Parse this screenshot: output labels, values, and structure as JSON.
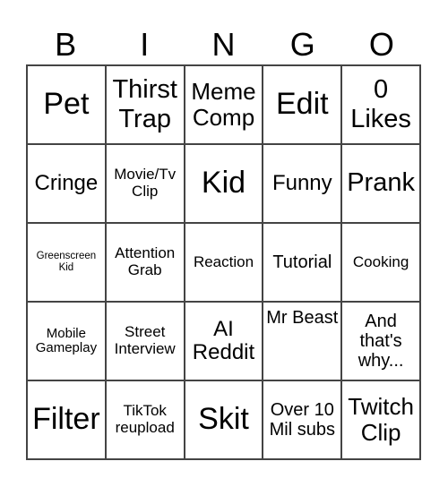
{
  "card": {
    "header": [
      "B",
      "I",
      "N",
      "G",
      "O"
    ],
    "rows": [
      [
        "Pet",
        "Thirst Trap",
        "Meme Comp",
        "Edit",
        "0 Likes"
      ],
      [
        "Cringe",
        "Movie/Tv Clip",
        "Kid",
        "Funny",
        "Prank"
      ],
      [
        "Greenscreen Kid",
        "Attention Grab",
        "Reaction",
        "Tutorial",
        "Cooking"
      ],
      [
        "Mobile Gameplay",
        "Street Interview",
        "AI Reddit",
        "Mr Beast",
        "And that's why..."
      ],
      [
        "Filter",
        "TikTok reupload",
        "Skit",
        "Over 10 Mil subs",
        "Twitch Clip"
      ]
    ]
  },
  "colors": {
    "grid_line": "#444444",
    "text": "#000000",
    "background": "#ffffff"
  }
}
